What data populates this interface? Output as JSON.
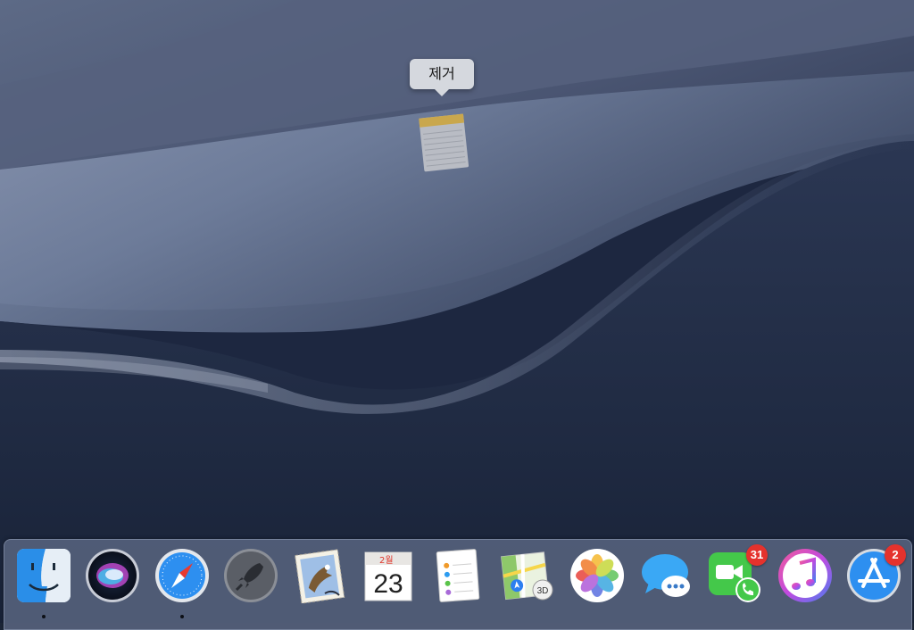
{
  "tooltip": {
    "label": "제거"
  },
  "dragged_item": {
    "icon": "notes-icon"
  },
  "dock": {
    "items": [
      {
        "id": "finder",
        "icon": "finder-icon",
        "running": true
      },
      {
        "id": "siri",
        "icon": "siri-icon",
        "running": false
      },
      {
        "id": "safari",
        "icon": "safari-icon",
        "running": true
      },
      {
        "id": "launchpad",
        "icon": "launchpad-icon",
        "running": false
      },
      {
        "id": "mail",
        "icon": "mail-icon",
        "running": false
      },
      {
        "id": "calendar",
        "icon": "calendar-icon",
        "month": "2월",
        "day": "23",
        "running": false
      },
      {
        "id": "reminders",
        "icon": "reminders-icon",
        "running": false
      },
      {
        "id": "maps",
        "icon": "maps-icon",
        "label_3d": "3D",
        "running": false
      },
      {
        "id": "photos",
        "icon": "photos-icon",
        "running": false
      },
      {
        "id": "messages",
        "icon": "messages-icon",
        "running": false
      },
      {
        "id": "facetime",
        "icon": "facetime-icon",
        "badge": "31",
        "running": false
      },
      {
        "id": "itunes",
        "icon": "itunes-icon",
        "running": false
      },
      {
        "id": "app-store",
        "icon": "app-store-icon",
        "badge": "2",
        "running": false
      }
    ]
  }
}
